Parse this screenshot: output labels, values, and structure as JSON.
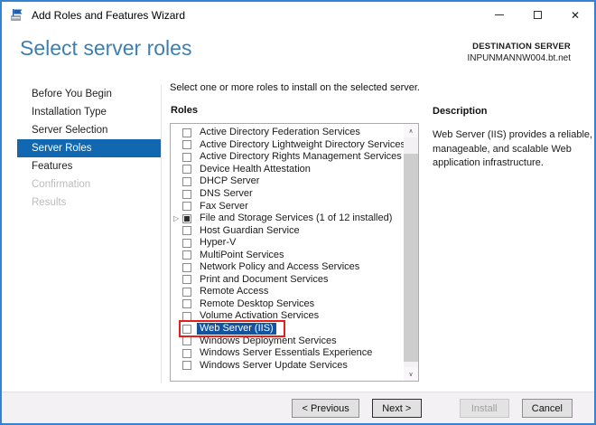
{
  "window": {
    "title": "Add Roles and Features Wizard"
  },
  "icons": {
    "app": "server-manager-flag",
    "minimize": "–",
    "maximize": "□",
    "close": "✕",
    "expand": "▷",
    "scroll_up": "∧",
    "scroll_down": "∨"
  },
  "header": {
    "title": "Select server roles",
    "destination_label": "DESTINATION SERVER",
    "destination_server": "INPUNMANNW004.bt.net"
  },
  "sidebar": {
    "items": [
      {
        "label": "Before You Begin",
        "state": "normal"
      },
      {
        "label": "Installation Type",
        "state": "normal"
      },
      {
        "label": "Server Selection",
        "state": "normal"
      },
      {
        "label": "Server Roles",
        "state": "selected"
      },
      {
        "label": "Features",
        "state": "normal"
      },
      {
        "label": "Confirmation",
        "state": "disabled"
      },
      {
        "label": "Results",
        "state": "disabled"
      }
    ]
  },
  "main": {
    "instruction": "Select one or more roles to install on the selected server.",
    "roles_label": "Roles",
    "roles": [
      {
        "label": "Active Directory Federation Services",
        "checked": false
      },
      {
        "label": "Active Directory Lightweight Directory Services",
        "checked": false
      },
      {
        "label": "Active Directory Rights Management Services",
        "checked": false
      },
      {
        "label": "Device Health Attestation",
        "checked": false
      },
      {
        "label": "DHCP Server",
        "checked": false
      },
      {
        "label": "DNS Server",
        "checked": false
      },
      {
        "label": "Fax Server",
        "checked": false
      },
      {
        "label": "File and Storage Services (1 of 12 installed)",
        "checked": "partial",
        "expandable": true
      },
      {
        "label": "Host Guardian Service",
        "checked": false
      },
      {
        "label": "Hyper-V",
        "checked": false
      },
      {
        "label": "MultiPoint Services",
        "checked": false
      },
      {
        "label": "Network Policy and Access Services",
        "checked": false
      },
      {
        "label": "Print and Document Services",
        "checked": false
      },
      {
        "label": "Remote Access",
        "checked": false
      },
      {
        "label": "Remote Desktop Services",
        "checked": false
      },
      {
        "label": "Volume Activation Services",
        "checked": false
      },
      {
        "label": "Web Server (IIS)",
        "checked": false,
        "selected": true,
        "annotated": true
      },
      {
        "label": "Windows Deployment Services",
        "checked": false
      },
      {
        "label": "Windows Server Essentials Experience",
        "checked": false
      },
      {
        "label": "Windows Server Update Services",
        "checked": false
      }
    ]
  },
  "description_panel": {
    "title": "Description",
    "text": "Web Server (IIS) provides a reliable, manageable, and scalable Web application infrastructure."
  },
  "footer": {
    "buttons": [
      {
        "label": "< Previous",
        "state": "enabled"
      },
      {
        "label": "Next >",
        "state": "default"
      },
      {
        "label": "Install",
        "state": "disabled"
      },
      {
        "label": "Cancel",
        "state": "enabled"
      }
    ]
  },
  "colors": {
    "window_border": "#3581d3",
    "header_title": "#3e7fb0",
    "nav_selected_bg": "#1168b0",
    "list_selected_bg": "#1254a2",
    "annotation_red": "#e4201e",
    "footer_bg": "#f4f1f4"
  }
}
